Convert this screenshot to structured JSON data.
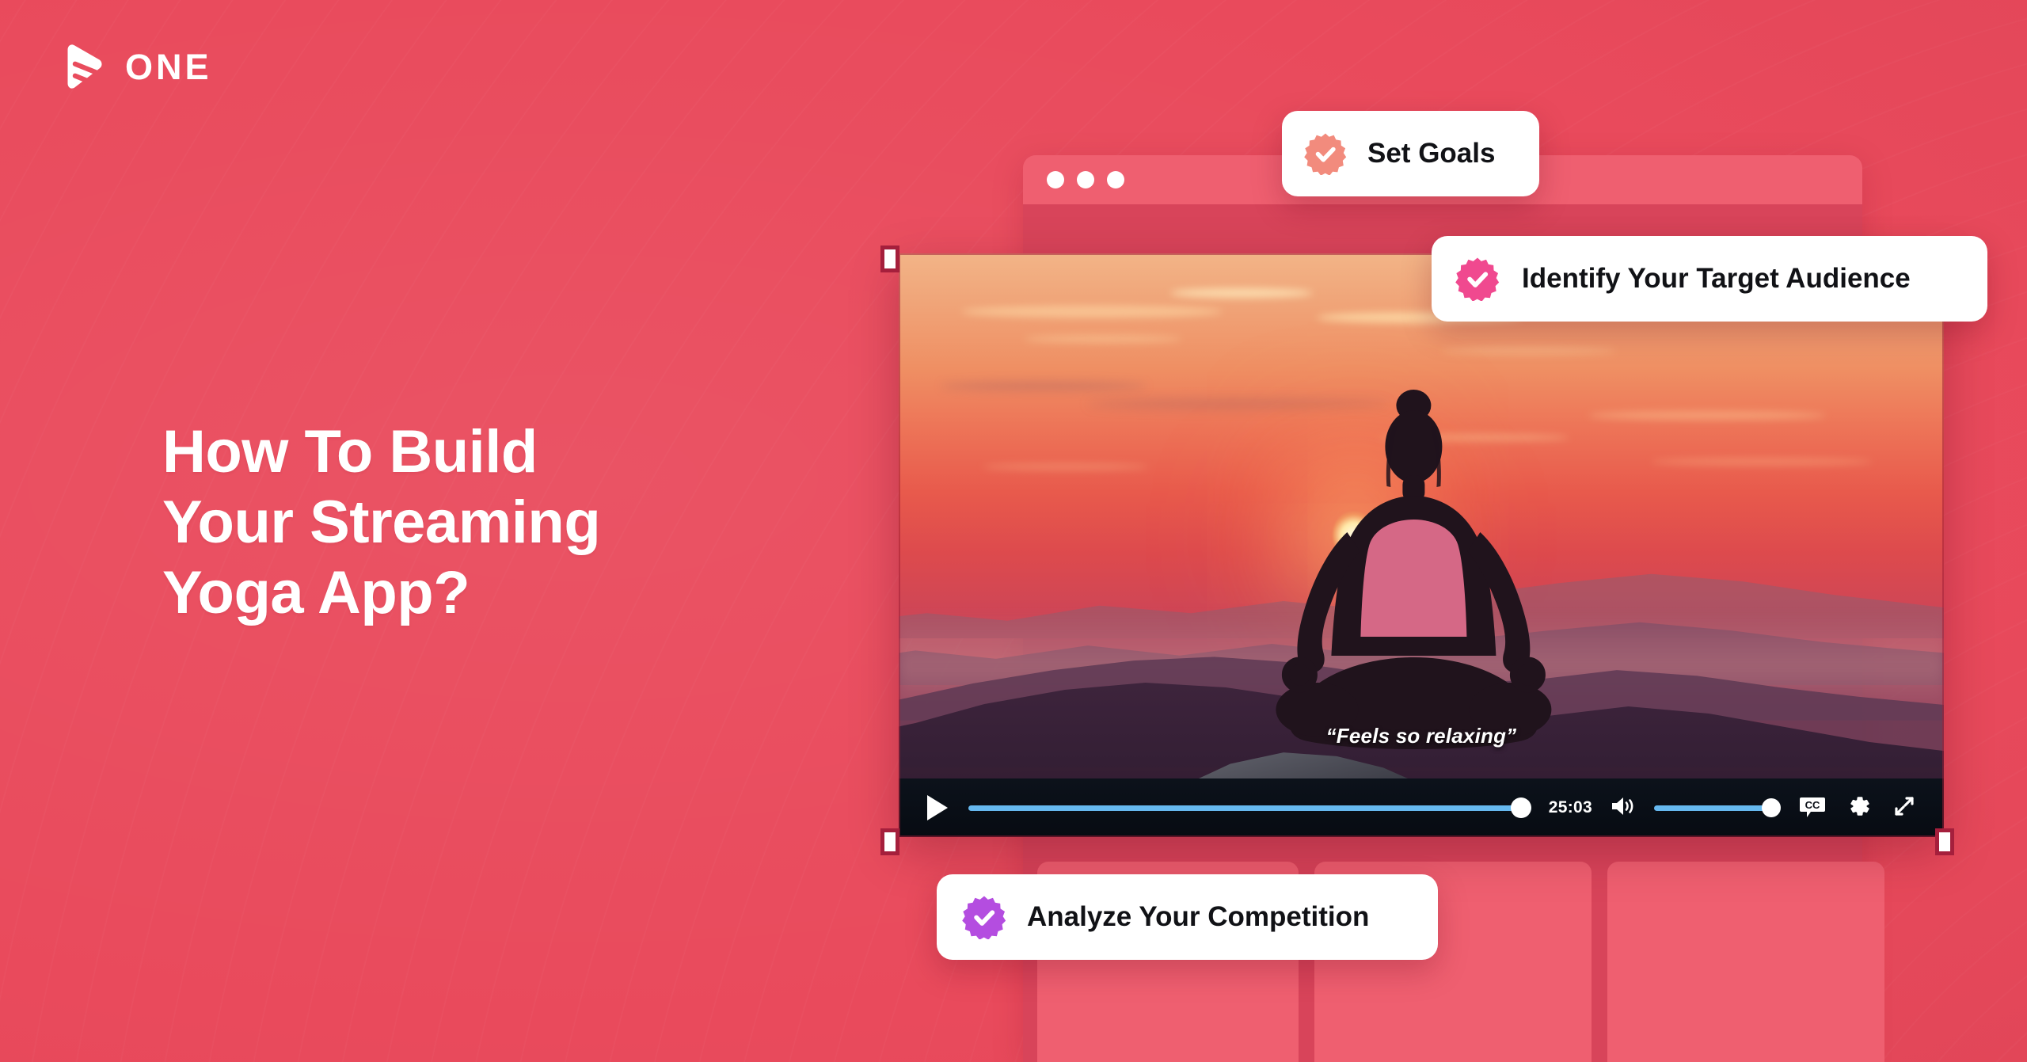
{
  "brand": {
    "name": "ONE",
    "logo_icon": "play-stripes-logo-icon",
    "color": "#ffffff"
  },
  "background": {
    "color": "#e94a5c"
  },
  "headline": {
    "text": "How To Build\nYour Streaming\nYoga App?",
    "color": "#ffffff"
  },
  "browser_mock": {
    "traffic_lights": [
      "dot-1",
      "dot-2",
      "dot-3"
    ],
    "bar_color": "#ef5f70",
    "body_color": "#d8445a",
    "placeholder_cards": [
      "card-1",
      "card-2",
      "card-3"
    ],
    "placeholder_color": "#ef5f70"
  },
  "video_player": {
    "selected": true,
    "scene_alt": "Woman meditating in lotus pose on a rock at sunset with mountains",
    "caption": "“Feels so relaxing”",
    "controls": {
      "play_icon": "play-icon",
      "play_label": "Play",
      "progress_percent": 96,
      "progress_color": "#66b8ef",
      "time_remaining": "25:03",
      "volume_icon": "volume-high-icon",
      "volume_percent": 90,
      "cc_icon": "closed-captions-icon",
      "cc_label": "CC",
      "settings_icon": "gear-icon",
      "fullscreen_icon": "fullscreen-expand-icon"
    },
    "selection_handles": [
      "top-left",
      "top-right",
      "bottom-left",
      "bottom-right"
    ],
    "handle_border_color": "#a51f3c"
  },
  "pills": [
    {
      "id": "set-goals",
      "label": "Set Goals",
      "badge_icon": "verified-check-badge-icon",
      "badge_color": "#f28b7d"
    },
    {
      "id": "identify-target-audience",
      "label": "Identify Your Target Audience",
      "badge_icon": "verified-check-badge-icon",
      "badge_color": "#f0498f"
    },
    {
      "id": "analyze-competition",
      "label": "Analyze Your Competition",
      "badge_icon": "verified-check-badge-icon",
      "badge_color": "#b44de0"
    }
  ]
}
